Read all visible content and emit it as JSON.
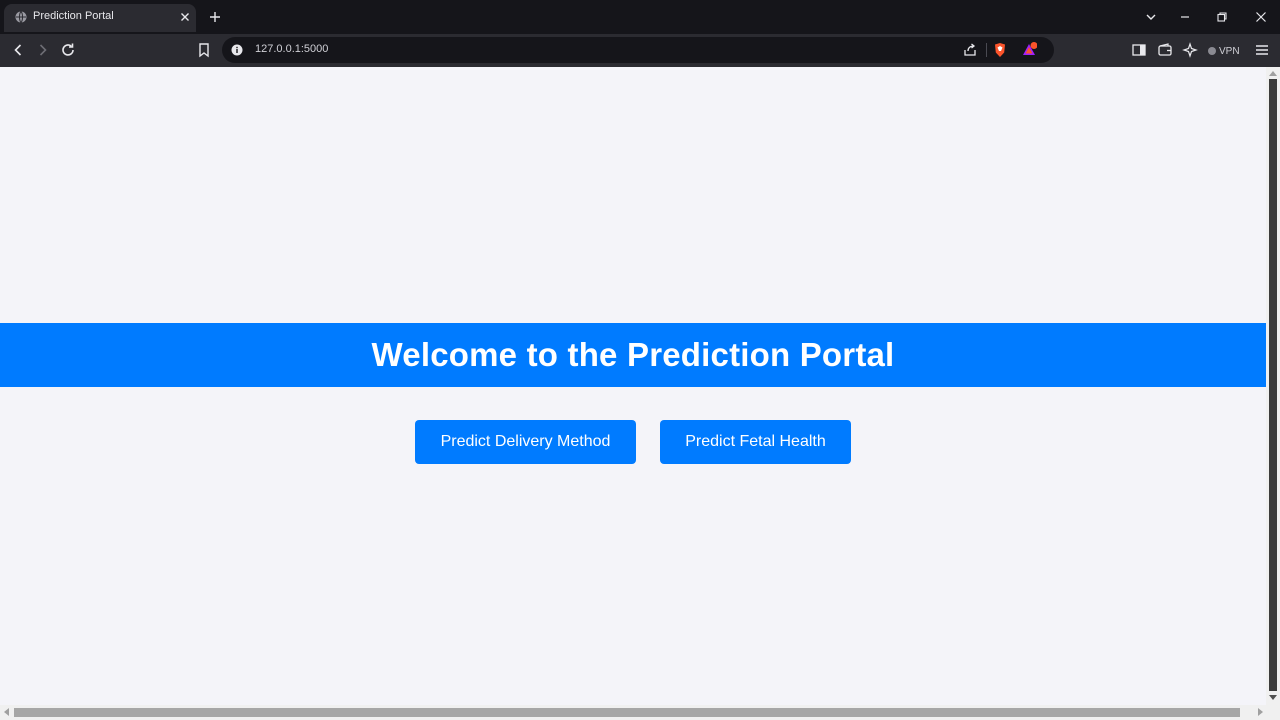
{
  "browser": {
    "tab": {
      "title": "Prediction Portal"
    },
    "address_bar": {
      "url": "127.0.0.1:5000"
    },
    "vpn": {
      "label": "VPN"
    },
    "colors": {
      "tabstrip": "#15151a",
      "toolbar": "#2b2b31",
      "brave_orange": "#fb542b"
    }
  },
  "page": {
    "heading": "Welcome to the Prediction Portal",
    "buttons": {
      "delivery": "Predict Delivery Method",
      "fetal": "Predict Fetal Health"
    },
    "colors": {
      "accent": "#007bff",
      "background": "#f4f4f9",
      "text_on_accent": "#ffffff"
    }
  }
}
